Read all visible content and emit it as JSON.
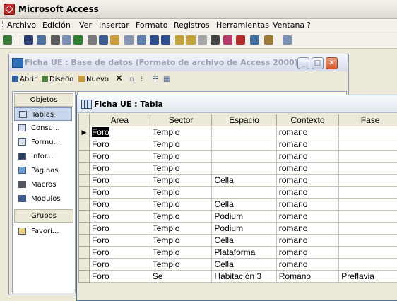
{
  "app": {
    "title": "Microsoft Access"
  },
  "menu": [
    "Archivo",
    "Edición",
    "Ver",
    "Insertar",
    "Formato",
    "Registros",
    "Herramientas",
    "Ventana",
    "?"
  ],
  "db_window": {
    "title": "Ficha UE : Base de datos (Formato de archivo de Access 2000)",
    "toolbar": {
      "open": "Abrir",
      "design": "Diseño",
      "new": "Nuevo"
    },
    "objects_header": "Objetos",
    "objects": [
      "Tablas",
      "Consu...",
      "Formu...",
      "Infor...",
      "Páginas",
      "Macros",
      "Módulos"
    ],
    "groups_header": "Grupos",
    "groups": [
      "Favori..."
    ]
  },
  "table_window": {
    "title": "Ficha UE : Tabla",
    "columns": [
      "Area",
      "Sector",
      "Espacio",
      "Contexto",
      "Fase"
    ],
    "current_row_marker": "▶",
    "rows": [
      [
        "Foro",
        "Templo",
        "",
        "romano",
        ""
      ],
      [
        "Foro",
        "Templo",
        "",
        "romano",
        ""
      ],
      [
        "Foro",
        "Templo",
        "",
        "romano",
        ""
      ],
      [
        "Foro",
        "Templo",
        "",
        "romano",
        ""
      ],
      [
        "Foro",
        "Templo",
        "Cella",
        "romano",
        ""
      ],
      [
        "Foro",
        "Templo",
        "",
        "romano",
        ""
      ],
      [
        "Foro",
        "Templo",
        "Cella",
        "romano",
        ""
      ],
      [
        "Foro",
        "Templo",
        "Podium",
        "romano",
        ""
      ],
      [
        "Foro",
        "Templo",
        "Podium",
        "romano",
        ""
      ],
      [
        "Foro",
        "Templo",
        "Cella",
        "romano",
        ""
      ],
      [
        "Foro",
        "Templo",
        "Plataforma",
        "romano",
        ""
      ],
      [
        "Foro",
        "Templo",
        "Cella",
        "romano",
        ""
      ],
      [
        "Foro",
        "Se",
        "Habitación 3",
        "Romano",
        "Preflavia"
      ]
    ]
  }
}
